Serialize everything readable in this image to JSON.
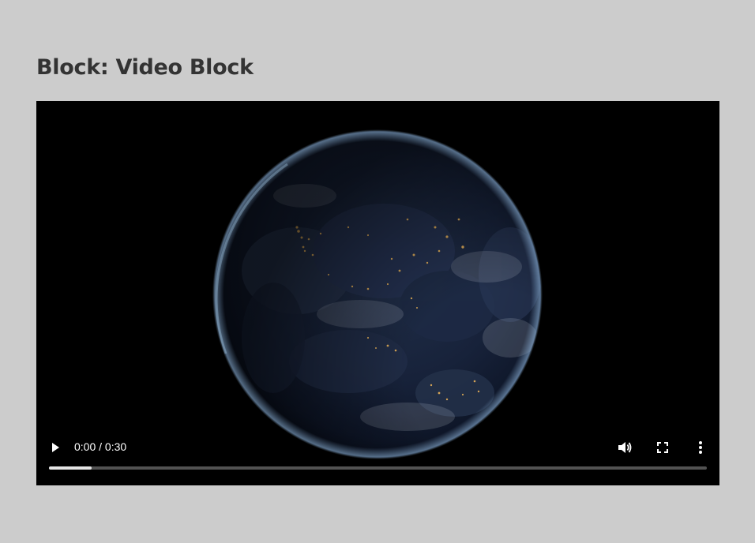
{
  "block": {
    "title": "Block: Video Block"
  },
  "video": {
    "current_time": "0:00",
    "duration": "0:30",
    "time_text": "0:00 / 0:30",
    "buffered_fraction": 0.065,
    "state": "paused"
  },
  "icons": {
    "play": "play-icon",
    "volume": "volume-icon",
    "fullscreen": "fullscreen-icon",
    "more": "more-options-icon"
  },
  "colors": {
    "page_background": "#cccccc",
    "title_text": "#333333",
    "video_background": "#000000",
    "controls_foreground": "#ffffff"
  }
}
